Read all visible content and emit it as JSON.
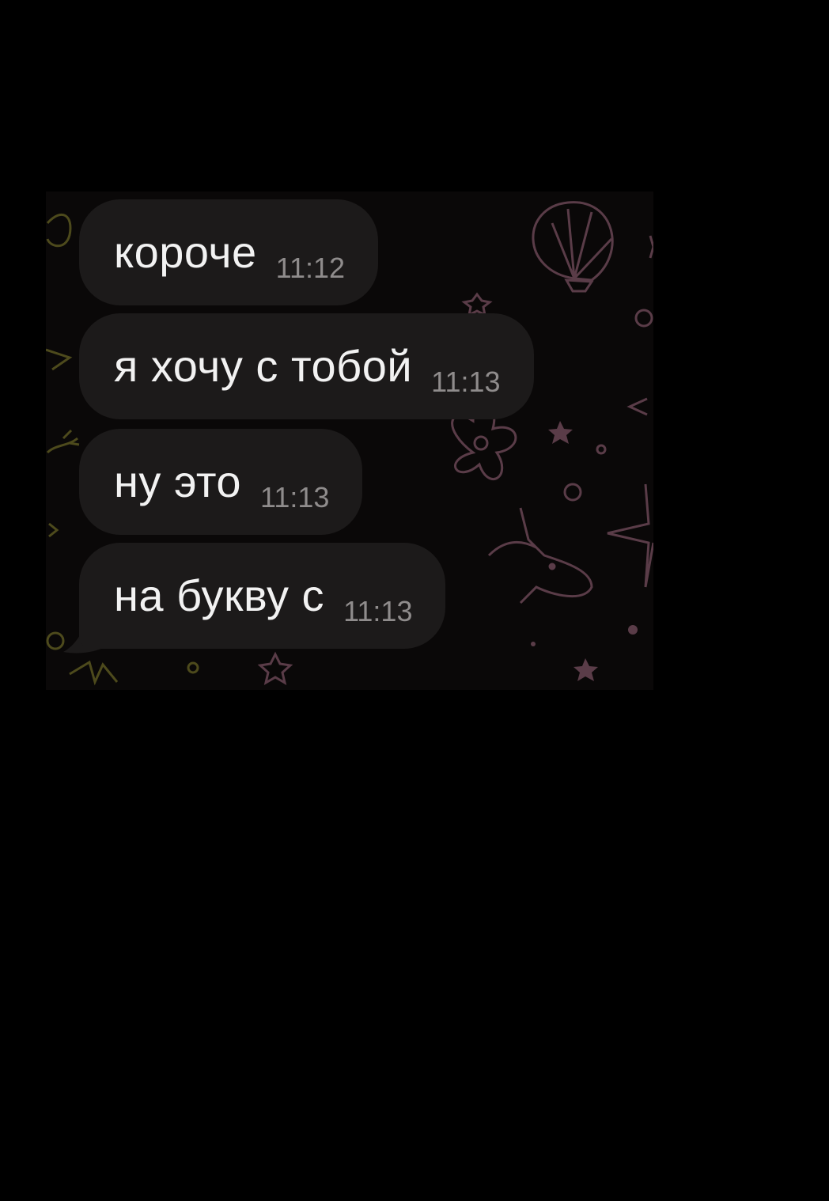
{
  "messages": [
    {
      "text": "короче",
      "time": "11:12"
    },
    {
      "text": "я хочу с тобой",
      "time": "11:13"
    },
    {
      "text": "ну это",
      "time": "11:13"
    },
    {
      "text": "на букву с",
      "time": "11:13"
    }
  ],
  "theme": {
    "background": "#000000",
    "bubble": "#1c1a1a",
    "text": "#f2f2f2",
    "time": "#8f8c8c",
    "doodle_gold": "#4d4a1c",
    "doodle_pink": "#5a3c48"
  },
  "wallpaper_icons": [
    "seashell-icon",
    "flower-icon",
    "unicorn-icon",
    "sparkle-star-icon",
    "star-icon",
    "circle-dot-icon"
  ]
}
